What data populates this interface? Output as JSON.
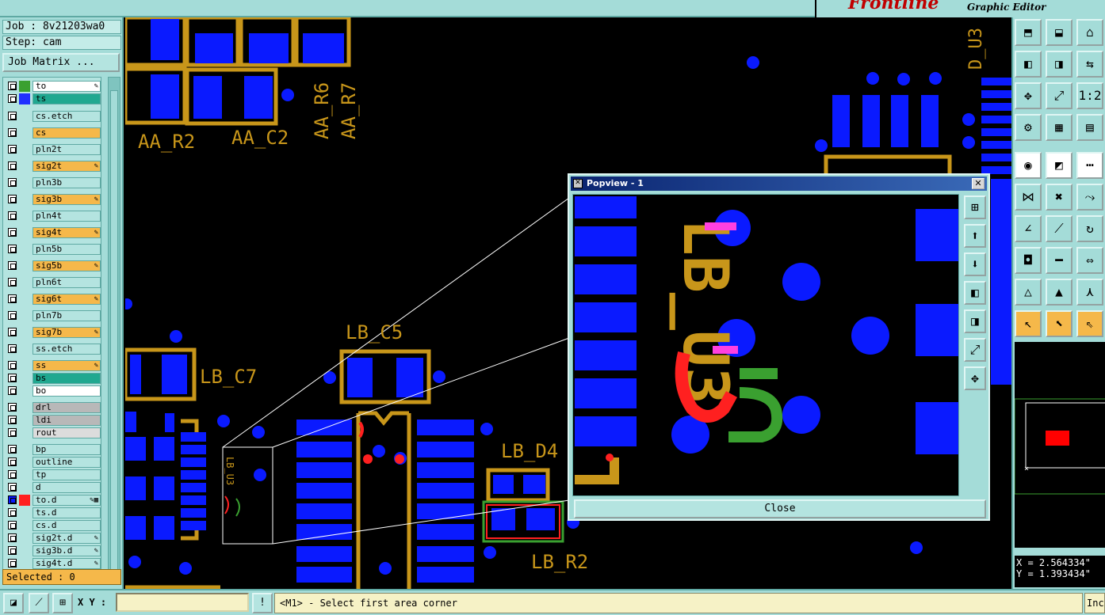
{
  "app": {
    "brand": "Frontline",
    "subtitle": "Graphic Editor"
  },
  "job": {
    "job_label": "Job : 8v21203wa0",
    "step_label": "Step: cam",
    "matrix_button": "Job Matrix ..."
  },
  "layers": [
    {
      "name": "to",
      "color": "#3aa030",
      "style": "white",
      "mark": "✎"
    },
    {
      "name": "ts",
      "color": "#2030ff",
      "style": "teal",
      "mark": ""
    },
    {
      "name": "cs.etch",
      "color": "",
      "style": "plain",
      "mark": ""
    },
    {
      "name": "cs",
      "color": "",
      "style": "orange",
      "mark": ""
    },
    {
      "name": "pln2t",
      "color": "",
      "style": "plain",
      "mark": ""
    },
    {
      "name": "sig2t",
      "color": "",
      "style": "orange",
      "mark": "✎"
    },
    {
      "name": "pln3b",
      "color": "",
      "style": "plain",
      "mark": ""
    },
    {
      "name": "sig3b",
      "color": "",
      "style": "orange",
      "mark": "✎"
    },
    {
      "name": "pln4t",
      "color": "",
      "style": "plain",
      "mark": ""
    },
    {
      "name": "sig4t",
      "color": "",
      "style": "orange",
      "mark": "✎"
    },
    {
      "name": "pln5b",
      "color": "",
      "style": "plain",
      "mark": ""
    },
    {
      "name": "sig5b",
      "color": "",
      "style": "orange",
      "mark": "✎"
    },
    {
      "name": "pln6t",
      "color": "",
      "style": "plain",
      "mark": ""
    },
    {
      "name": "sig6t",
      "color": "",
      "style": "orange",
      "mark": "✎"
    },
    {
      "name": "pln7b",
      "color": "",
      "style": "plain",
      "mark": ""
    },
    {
      "name": "sig7b",
      "color": "",
      "style": "orange",
      "mark": "✎"
    },
    {
      "name": "ss.etch",
      "color": "",
      "style": "plain",
      "mark": ""
    },
    {
      "name": "ss",
      "color": "",
      "style": "orange",
      "mark": "✎"
    },
    {
      "name": "bs",
      "color": "",
      "style": "teal",
      "mark": ""
    },
    {
      "name": "bo",
      "color": "",
      "style": "white",
      "mark": ""
    },
    {
      "name": "drl",
      "color": "",
      "style": "grey",
      "mark": ""
    },
    {
      "name": "ldi",
      "color": "",
      "style": "grey",
      "mark": ""
    },
    {
      "name": "rout",
      "color": "",
      "style": "lightgrey",
      "mark": ""
    },
    {
      "name": "bp",
      "color": "",
      "style": "plain",
      "mark": ""
    },
    {
      "name": "outline",
      "color": "",
      "style": "plain",
      "mark": ""
    },
    {
      "name": "tp",
      "color": "",
      "style": "plain",
      "mark": ""
    },
    {
      "name": "d",
      "color": "",
      "style": "plain",
      "mark": ""
    },
    {
      "name": "to.d",
      "color": "#ff2020",
      "style": "plain",
      "mark": "✎▦"
    },
    {
      "name": "ts.d",
      "color": "",
      "style": "plain",
      "mark": ""
    },
    {
      "name": "cs.d",
      "color": "",
      "style": "plain",
      "mark": ""
    },
    {
      "name": "sig2t.d",
      "color": "",
      "style": "plain",
      "mark": "✎"
    },
    {
      "name": "sig3b.d",
      "color": "",
      "style": "plain",
      "mark": "✎"
    },
    {
      "name": "sig4t.d",
      "color": "",
      "style": "plain",
      "mark": "✎"
    }
  ],
  "selected": "Selected : 0",
  "canvas_labels": {
    "aa_r2": "AA_R2",
    "aa_c2": "AA_C2",
    "aa_r6": "AA_R6",
    "aa_r7": "AA_R7",
    "lb_c5": "LB_C5",
    "lb_c7": "LB_C7",
    "lb_d4": "LB_D4",
    "lb_r2": "LB_R2",
    "d_u3": "D_U3",
    "lb_u3_small": "LB_U3"
  },
  "popview": {
    "title": "Popview - 1",
    "close_label": "Close",
    "label_lb": "LB_U3"
  },
  "right_tools": [
    "fit-screen",
    "zoom-area",
    "home",
    "pan-left",
    "pan-right",
    "flip",
    "zoom-center",
    "zoom-fit",
    "scale-1-2",
    "snap",
    "grid",
    "layer-colors",
    "measure-point",
    "line-color",
    "ruler",
    "net",
    "cross",
    "connect",
    "angle-line",
    "diag-line",
    "rotate",
    "drc-point",
    "trace",
    "dim",
    "triangle-a",
    "triangle-b",
    "triangle-c",
    "cursor-a",
    "cursor-b",
    "cursor-c"
  ],
  "coords": {
    "x": "X = 2.564334\"",
    "y": "Y = 1.393434\""
  },
  "bottom": {
    "xy_label": "X Y :",
    "xy_value": "",
    "message": "<M1> - Select first area corner",
    "inc_label": "Inc"
  },
  "colors": {
    "panel": "#a4dcd8",
    "copper": "#c8961a",
    "pad": "#0a1aff",
    "silk_red": "#ff2020",
    "silk_green": "#3aa030"
  }
}
